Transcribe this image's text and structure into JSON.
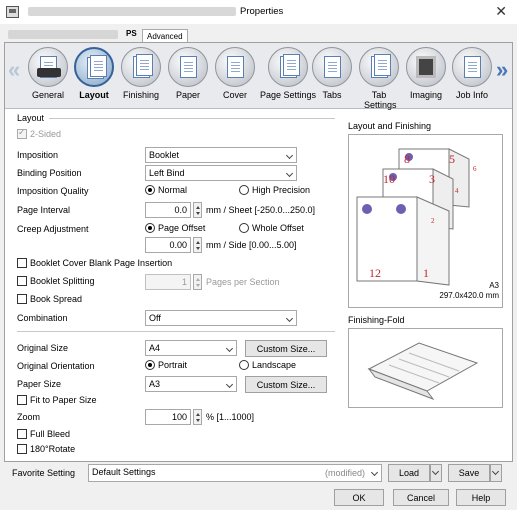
{
  "window": {
    "title": "Properties",
    "close_glyph": "✕"
  },
  "top_tabs": {
    "ps": "PS",
    "advanced": "Advanced"
  },
  "nav": {
    "prev_glyph": "«",
    "next_glyph": "»",
    "tabs": [
      {
        "label": "General",
        "icon": "general-icon"
      },
      {
        "label": "Layout",
        "icon": "layout-icon",
        "active": true
      },
      {
        "label": "Finishing",
        "icon": "finishing-icon"
      },
      {
        "label": "Paper",
        "icon": "paper-icon"
      },
      {
        "label": "Cover",
        "icon": "cover-icon"
      },
      {
        "label": "Page Settings",
        "icon": "page-settings-icon"
      },
      {
        "label": "Tabs",
        "icon": "tabs-icon"
      },
      {
        "label": "Tab Settings",
        "icon": "tab-settings-icon"
      },
      {
        "label": "Imaging",
        "icon": "imaging-icon"
      },
      {
        "label": "Job Info",
        "icon": "job-info-icon"
      }
    ]
  },
  "layout": {
    "section_title": "Layout",
    "two_sided": "2-Sided",
    "imposition": {
      "label": "Imposition",
      "value": "Booklet"
    },
    "binding_position": {
      "label": "Binding Position",
      "value": "Left Bind"
    },
    "imposition_quality": {
      "label": "Imposition Quality",
      "normal": "Normal",
      "high": "High Precision"
    },
    "page_interval": {
      "label": "Page Interval",
      "value": "0.0",
      "unit": "mm / Sheet [-250.0...250.0]"
    },
    "creep": {
      "label": "Creep Adjustment",
      "page_offset": "Page Offset",
      "whole_offset": "Whole Offset",
      "value": "0.00",
      "unit": "mm / Side [0.00...5.00]"
    },
    "booklet_cover_blank": "Booklet Cover Blank Page Insertion",
    "booklet_splitting": "Booklet Splitting",
    "pages_per_section": {
      "value": "1",
      "unit": "Pages per Section"
    },
    "book_spread": "Book Spread",
    "combination": {
      "label": "Combination",
      "value": "Off"
    },
    "original_size": {
      "label": "Original Size",
      "value": "A4",
      "button": "Custom Size..."
    },
    "original_orientation": {
      "label": "Original Orientation",
      "portrait": "Portrait",
      "landscape": "Landscape"
    },
    "paper_size": {
      "label": "Paper Size",
      "value": "A3",
      "button": "Custom Size..."
    },
    "fit_to_paper": "Fit to Paper Size",
    "zoom": {
      "label": "Zoom",
      "value": "100",
      "unit": "% [1...1000]"
    },
    "full_bleed": "Full Bleed",
    "rotate180": "180°Rotate"
  },
  "preview": {
    "title": "Layout and Finishing",
    "paper": "A3",
    "dimensions": "297.0x420.0 mm",
    "page_numbers": [
      "8",
      "5",
      "10",
      "3",
      "12",
      "1",
      "6",
      "4",
      "2"
    ],
    "finishing_title": "Finishing-Fold"
  },
  "footer": {
    "favorite_label": "Favorite Setting",
    "favorite_value": "Default Settings",
    "favorite_state": "(modified)",
    "load": "Load",
    "save": "Save",
    "ok": "OK",
    "cancel": "Cancel",
    "help": "Help"
  },
  "colors": {
    "accent": "#36629a",
    "page_number": "#c0282d",
    "flower": "#6e5fb0"
  }
}
